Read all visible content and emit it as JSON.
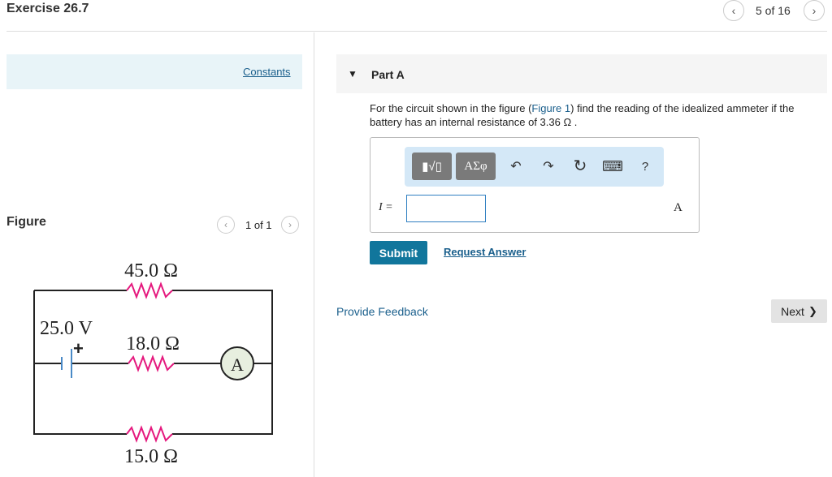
{
  "header": {
    "title": "Exercise 26.7",
    "prev_icon": "‹",
    "counter": "5 of 16",
    "next_icon": "›"
  },
  "left": {
    "constants_link": "Constants",
    "figure_label": "Figure",
    "pager": {
      "prev": "‹",
      "text": "1 of 1",
      "next": "›"
    }
  },
  "circuit": {
    "r_top": "45.0 Ω",
    "battery": "25.0 V",
    "battery_plus": "+",
    "r_mid": "18.0 Ω",
    "ammeter": "A",
    "r_bottom": "15.0 Ω",
    "resistor_color": "#e5197e"
  },
  "part": {
    "toggle": "▼",
    "title": "Part A",
    "question_pre": "For the circuit shown in the figure (",
    "figure_link": "Figure 1",
    "question_post": ") find the reading of the idealized ammeter if the battery has an internal resistance of 3.36 Ω ."
  },
  "answer": {
    "toolbar": {
      "templates_label": "▮√▯",
      "symbols_label": "ΑΣφ",
      "undo": "↶",
      "redo": "↷",
      "reset": "↻",
      "keyboard": "⌨",
      "help": "?"
    },
    "var_label": "I =",
    "value": "",
    "unit": "A"
  },
  "actions": {
    "submit": "Submit",
    "request": "Request Answer",
    "feedback": "Provide Feedback",
    "next": "Next",
    "next_icon": "❯"
  }
}
